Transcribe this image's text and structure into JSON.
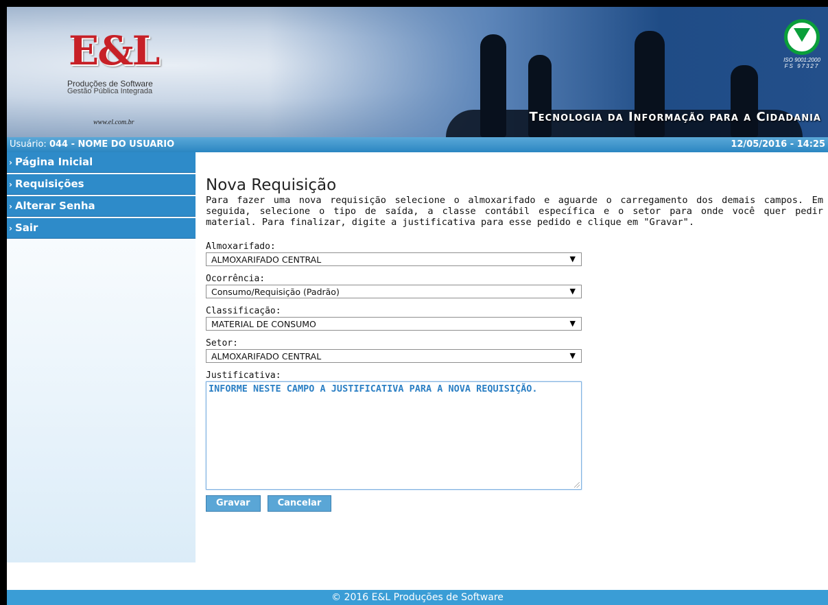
{
  "banner": {
    "logo_text": "E&L",
    "logo_sub1": "Produções de Software",
    "logo_sub2": "Gestão Pública Integrada",
    "logo_site": "www.el.com.br",
    "iso_line1": "ISO 9001:2000",
    "iso_line2": "FS 97327",
    "tagline": "Tecnologia da Informação para a Cidadania"
  },
  "infobar": {
    "user_label": "Usuário:",
    "user_value": "044 - NOME DO USUARIO",
    "datetime": "12/05/2016 - 14:25"
  },
  "sidebar": {
    "items": [
      {
        "label": "Página Inicial"
      },
      {
        "label": "Requisições"
      },
      {
        "label": "Alterar Senha"
      },
      {
        "label": "Sair"
      }
    ],
    "arrow": "›"
  },
  "main": {
    "title": "Nova Requisição",
    "intro": "Para fazer uma nova requisição selecione o almoxarifado e aguarde o carregamento dos demais campos. Em seguida, selecione o tipo de saída, a classe contábil específica e o setor para onde você quer pedir material. Para finalizar, digite a justificativa para esse pedido e clique em \"Gravar\".",
    "fields": {
      "almoxarifado": {
        "label": "Almoxarifado:",
        "value": "ALMOXARIFADO CENTRAL"
      },
      "ocorrencia": {
        "label": "Ocorrência:",
        "value": "Consumo/Requisição (Padrão)"
      },
      "classificacao": {
        "label": "Classificação:",
        "value": "MATERIAL DE CONSUMO"
      },
      "setor": {
        "label": "Setor:",
        "value": "ALMOXARIFADO CENTRAL"
      },
      "justificativa": {
        "label": "Justificativa:",
        "value": "INFORME NESTE CAMPO A JUSTIFICATIVA PARA A NOVA REQUISIÇÃO."
      }
    },
    "buttons": {
      "save": "Gravar",
      "cancel": "Cancelar"
    },
    "caret": "▼"
  },
  "footer": {
    "text": "© 2016 E&L Produções de Software"
  },
  "colors": {
    "accent": "#2e8bc9",
    "textarea_text": "#2b7fc4",
    "logo_red": "#c72027"
  }
}
